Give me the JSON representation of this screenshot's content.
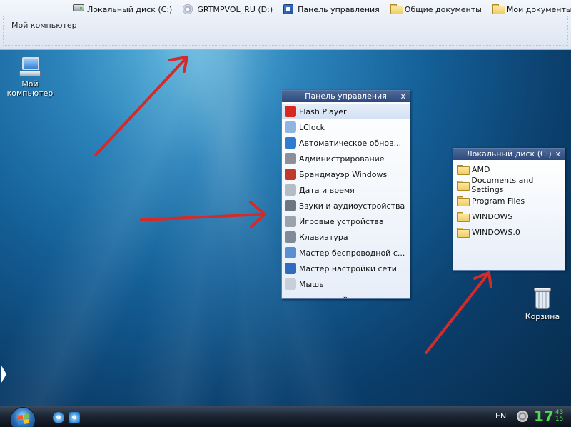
{
  "top_panel": {
    "title": "Мой компьютер",
    "links": [
      {
        "label": "Локальный диск (C:)",
        "icon": "drive-icon"
      },
      {
        "label": "GRTMPVOL_RU (D:)",
        "icon": "cd-icon"
      },
      {
        "label": "Панель управления",
        "icon": "control-panel-icon"
      },
      {
        "label": "Общие документы",
        "icon": "folder-icon"
      },
      {
        "label": "Мои документы",
        "icon": "folder-icon"
      }
    ]
  },
  "desktop": {
    "my_computer": "Мой\nкомпьютер",
    "recycle_bin": "Корзина"
  },
  "control_panel": {
    "title": "Панель управления",
    "close": "x",
    "items": [
      {
        "label": "Flash Player",
        "color": "#d62a1e"
      },
      {
        "label": "LClock",
        "color": "#8fb6e0"
      },
      {
        "label": "Автоматическое обнов...",
        "color": "#2f7bd0"
      },
      {
        "label": "Администрирование",
        "color": "#8a8f98"
      },
      {
        "label": "Брандмауэр Windows",
        "color": "#c0392b"
      },
      {
        "label": "Дата и время",
        "color": "#b4bcc6"
      },
      {
        "label": "Звуки и аудиоустройства",
        "color": "#6d7782"
      },
      {
        "label": "Игровые устройства",
        "color": "#9aa3ad"
      },
      {
        "label": "Клавиатура",
        "color": "#7f8b99"
      },
      {
        "label": "Мастер беспроводной с...",
        "color": "#5b8fd1"
      },
      {
        "label": "Мастер настройки сети",
        "color": "#2e6cc0"
      },
      {
        "label": "Мышь",
        "color": "#c9cfd6"
      }
    ],
    "more": "»"
  },
  "disk_panel": {
    "title": "Локальный диск (C:)",
    "close": "x",
    "items": [
      "AMD",
      "Documents and Settings",
      "Program Files",
      "WINDOWS",
      "WINDOWS.0"
    ]
  },
  "taskbar": {
    "lang": "EN",
    "clock_hour": "17",
    "clock_min_top": "43",
    "clock_min_bottom": "15"
  },
  "colors": {
    "arrow": "#d42a2a",
    "popup_title": "#3b5888",
    "clock": "#4ddc4d"
  }
}
